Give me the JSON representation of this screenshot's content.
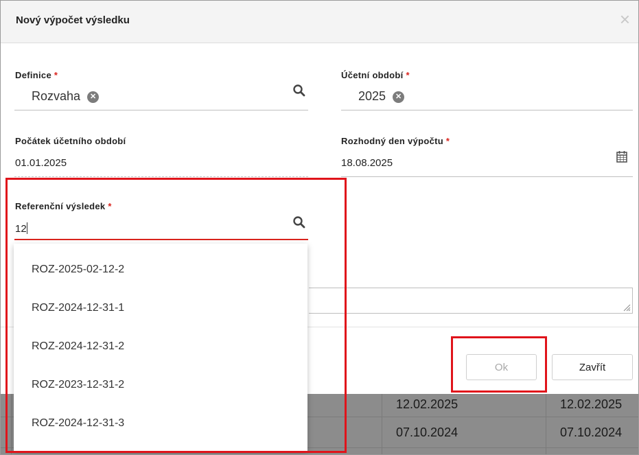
{
  "dialog": {
    "title": "Nový výpočet výsledku",
    "close_symbol": "×"
  },
  "form": {
    "required_mark": "*",
    "definition": {
      "label": "Definice",
      "value": "Rozvaha",
      "clear_symbol": "✕"
    },
    "accounting_period": {
      "label": "Účetní období",
      "value": "2025",
      "clear_symbol": "✕"
    },
    "period_start": {
      "label": "Počátek účetního období",
      "value": "01.01.2025"
    },
    "decisive_date": {
      "label": "Rozhodný den výpočtu",
      "value": "18.08.2025"
    },
    "reference_result": {
      "label": "Referenční výsledek",
      "value": "12",
      "options": [
        "ROZ-2025-02-12-2",
        "ROZ-2024-12-31-1",
        "ROZ-2024-12-31-2",
        "ROZ-2023-12-31-2",
        "ROZ-2024-12-31-3"
      ]
    }
  },
  "buttons": {
    "ok": "Ok",
    "close": "Zavřít"
  },
  "background_table": {
    "rows": [
      {
        "col_a": "12.02.2025",
        "col_b": "12.02.2025"
      },
      {
        "col_a": "07.10.2024",
        "col_b": "07.10.2024"
      }
    ]
  },
  "colors": {
    "highlight": "#e0141b",
    "required": "#d9231d",
    "input_focus": "#d9231d"
  }
}
